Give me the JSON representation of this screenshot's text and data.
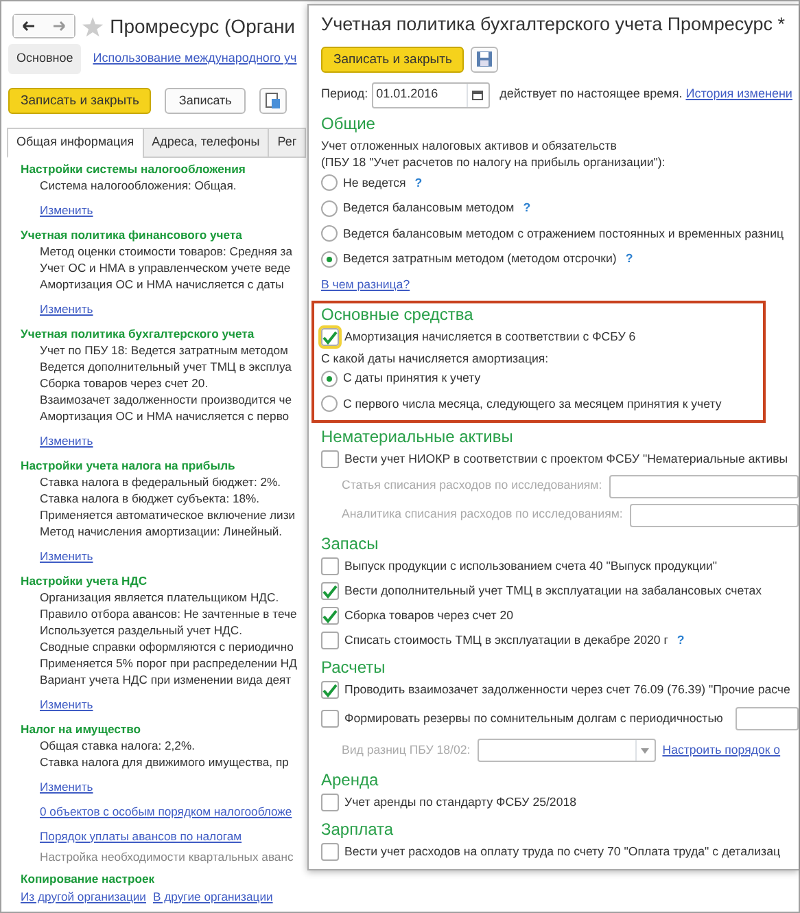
{
  "back_window": {
    "title": "Промресурс (Органи",
    "view_tabs": [
      {
        "label": "Основное",
        "selected": true
      },
      {
        "label": "Использование международного уч",
        "selected": false
      }
    ],
    "buttons": [
      {
        "label": "Записать и закрыть",
        "kind": "primary"
      },
      {
        "label": "Записать",
        "kind": "default"
      },
      {
        "kind": "icon"
      }
    ],
    "tabs": [
      {
        "label": "Общая информация",
        "selected": true
      },
      {
        "label": "Адреса, телефоны",
        "selected": false
      },
      {
        "label": "Рег",
        "selected": false
      }
    ],
    "content": [
      {
        "kind": "heading",
        "text": "Настройки системы налогообложения"
      },
      {
        "kind": "text",
        "text": "Система налогообложения: Общая."
      },
      {
        "kind": "link",
        "text": "Изменить"
      },
      {
        "kind": "heading",
        "text": "Учетная политика финансового учета"
      },
      {
        "kind": "text",
        "text": "Метод оценки стоимости товаров: Средняя за"
      },
      {
        "kind": "text",
        "text": "Учет ОС и НМА в управленческом учете веде"
      },
      {
        "kind": "text",
        "text": "Амортизация ОС и НМА начисляется с даты"
      },
      {
        "kind": "link",
        "text": "Изменить"
      },
      {
        "kind": "heading",
        "text": "Учетная политика бухгалтерского учета"
      },
      {
        "kind": "text",
        "text": "Учет по ПБУ 18: Ведется затратным методом"
      },
      {
        "kind": "text",
        "text": "Ведется дополнительный учет ТМЦ в эксплуа"
      },
      {
        "kind": "text",
        "text": "Сборка товаров через счет 20."
      },
      {
        "kind": "text",
        "text": "Взаимозачет задолженности производится че"
      },
      {
        "kind": "text",
        "text": "Амортизация ОС и НМА начисляется с перво"
      },
      {
        "kind": "link",
        "text": "Изменить"
      },
      {
        "kind": "heading",
        "text": "Настройки учета налога на прибыль"
      },
      {
        "kind": "text",
        "text": "Ставка налога в федеральный бюджет: 2%."
      },
      {
        "kind": "text",
        "text": "Ставка налога в бюджет субъекта: 18%."
      },
      {
        "kind": "text",
        "text": "Применяется автоматическое включение лизи"
      },
      {
        "kind": "text",
        "text": "Метод начисления амортизации: Линейный."
      },
      {
        "kind": "link",
        "text": "Изменить"
      },
      {
        "kind": "heading",
        "text": "Настройки учета НДС"
      },
      {
        "kind": "text",
        "text": "Организация является плательщиком НДС."
      },
      {
        "kind": "text",
        "text": "Правило отбора авансов: Не зачтенные в тече"
      },
      {
        "kind": "text",
        "text": "Используется раздельный учет НДС."
      },
      {
        "kind": "text",
        "text": "Сводные справки оформляются с периодично"
      },
      {
        "kind": "text",
        "text": "Применяется 5% порог при распределении НД"
      },
      {
        "kind": "text",
        "text": "Вариант учета НДС при изменении вида деят"
      },
      {
        "kind": "link",
        "text": "Изменить"
      },
      {
        "kind": "heading",
        "text": "Налог на имущество"
      },
      {
        "kind": "text",
        "text": "Общая ставка налога: 2,2%."
      },
      {
        "kind": "text",
        "text": "Ставка налога для движимого имущества, пр"
      },
      {
        "kind": "link",
        "text": "Изменить"
      },
      {
        "kind": "link",
        "text": "0 объектов с особым порядком налогообложе"
      },
      {
        "kind": "link",
        "text": "Порядок уплаты авансов по налогам"
      },
      {
        "kind": "note",
        "text": "Настройка необходимости квартальных аванс"
      },
      {
        "kind": "heading",
        "text": "Копирование настроек"
      },
      {
        "kind": "links",
        "items": [
          "Из другой организации",
          "В другие организации"
        ]
      }
    ]
  },
  "front_window": {
    "title": "Учетная политика бухгалтерского учета Промресурс *",
    "save_close": "Записать и закрыть",
    "period": {
      "label": "Период:",
      "value": "01.01.2016",
      "status": "действует по настоящее время.",
      "link": "История изменени"
    },
    "sections": [
      {
        "title": "Общие",
        "highlighted": false,
        "items": [
          {
            "kind": "text",
            "text": "Учет отложенных налоговых активов и обязательств"
          },
          {
            "kind": "text",
            "text": "(ПБУ 18 \"Учет расчетов по налогу на прибыль организации\"):"
          },
          {
            "kind": "radio",
            "label": "Не ведется",
            "selected": false,
            "help": "?"
          },
          {
            "kind": "radio",
            "label": "Ведется балансовым методом",
            "selected": false,
            "help": "?"
          },
          {
            "kind": "radio",
            "label": "Ведется балансовым методом с отражением постоянных и временных разниц",
            "selected": false
          },
          {
            "kind": "radio",
            "label": "Ведется затратным методом (методом отсрочки)",
            "selected": true,
            "help": "?"
          },
          {
            "kind": "link",
            "text": "В чем разница?"
          }
        ]
      },
      {
        "title": "Основные средства",
        "highlighted": true,
        "items": [
          {
            "kind": "checkbox",
            "label": "Амортизация начисляется в соответствии с ФСБУ 6",
            "checked": true,
            "focused": true
          },
          {
            "kind": "text",
            "text": "С какой даты начисляется амортизация:"
          },
          {
            "kind": "radio",
            "label": "С даты принятия к учету",
            "selected": true
          },
          {
            "kind": "radio",
            "label": "С первого числа месяца, следующего за месяцем принятия к учету",
            "selected": false
          }
        ]
      },
      {
        "title": "Нематериальные активы",
        "highlighted": false,
        "items": [
          {
            "kind": "checkbox",
            "label": "Вести учет НИОКР в соответствии с проектом ФСБУ \"Нематериальные активы",
            "checked": false
          },
          {
            "kind": "field",
            "label": "Статья списания расходов по исследованиям:"
          },
          {
            "kind": "field",
            "label": "Аналитика списания расходов по исследованиям:"
          }
        ]
      },
      {
        "title": "Запасы",
        "highlighted": false,
        "items": [
          {
            "kind": "checkbox",
            "label": "Выпуск продукции с использованием счета 40 \"Выпуск продукции\"",
            "checked": false
          },
          {
            "kind": "checkbox",
            "label": "Вести дополнительный учет ТМЦ в эксплуатации на забалансовых счетах",
            "checked": true
          },
          {
            "kind": "checkbox",
            "label": "Сборка товаров через счет 20",
            "checked": true
          },
          {
            "kind": "checkbox",
            "label": "Списать стоимость ТМЦ в эксплуатации в декабре 2020 г",
            "checked": false,
            "help": "?"
          }
        ]
      },
      {
        "title": "Расчеты",
        "highlighted": false,
        "items": [
          {
            "kind": "checkbox",
            "label": "Проводить взаимозачет задолженности через счет 76.09 (76.39) \"Прочие расче",
            "checked": true
          },
          {
            "kind": "checkbox-field",
            "label": "Формировать резервы по сомнительным долгам с периодичностью",
            "checked": false
          },
          {
            "kind": "select",
            "label": "Вид разниц ПБУ 18/02:",
            "link": "Настроить порядок о"
          }
        ]
      },
      {
        "title": "Аренда",
        "highlighted": false,
        "items": [
          {
            "kind": "checkbox",
            "label": "Учет аренды по стандарту ФСБУ 25/2018",
            "checked": false
          }
        ]
      },
      {
        "title": "Зарплата",
        "highlighted": false,
        "items": [
          {
            "kind": "checkbox",
            "label": "Вести учет расходов на оплату труда по счету 70 \"Оплата труда\" с детализац",
            "checked": false
          }
        ]
      }
    ]
  }
}
